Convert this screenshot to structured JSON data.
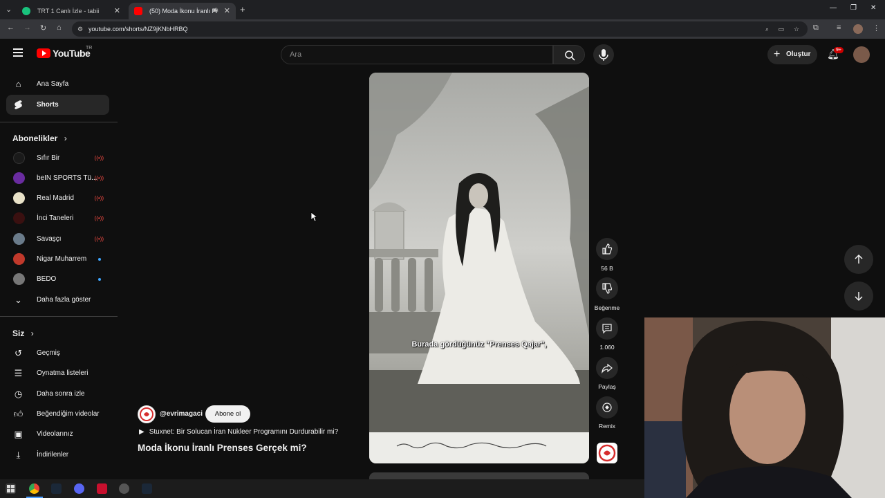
{
  "browser": {
    "tabs": [
      {
        "title": "TRT 1 Canlı İzle - tabii",
        "active": false
      },
      {
        "title": "(50) Moda İkonu İranlı Pren...",
        "active": true
      }
    ],
    "url": "youtube.com/shorts/NZ9jKNbHRBQ"
  },
  "header": {
    "logo_text": "YouTube",
    "region": "TR",
    "search_placeholder": "Ara",
    "create_label": "Oluştur",
    "notifications_badge": "9+"
  },
  "sidebar": {
    "main": [
      {
        "label": "Ana Sayfa",
        "icon": "home-icon"
      },
      {
        "label": "Shorts",
        "icon": "shorts-icon",
        "active": true
      }
    ],
    "subscriptions_title": "Abonelikler",
    "subscriptions": [
      {
        "name": "Sıfır Bir",
        "status": "live",
        "color": "#1a1a1a"
      },
      {
        "name": "beIN SPORTS Tü...",
        "status": "live",
        "color": "#6a2ca0"
      },
      {
        "name": "Real Madrid",
        "status": "live",
        "color": "#e9e2c8"
      },
      {
        "name": "İnci Taneleri",
        "status": "live",
        "color": "#3a1010"
      },
      {
        "name": "Savaşçı",
        "status": "live",
        "color": "#6a7b8a"
      },
      {
        "name": "Nigar Muharrem",
        "status": "new",
        "color": "#c0392b"
      },
      {
        "name": "BEDO",
        "status": "new",
        "color": "#777777"
      }
    ],
    "show_more_label": "Daha fazla göster",
    "you_title": "Siz",
    "you_items": [
      {
        "label": "Geçmiş",
        "icon": "history-icon"
      },
      {
        "label": "Oynatma listeleri",
        "icon": "playlist-icon"
      },
      {
        "label": "Daha sonra izle",
        "icon": "clock-icon"
      },
      {
        "label": "Beğendiğim videolar",
        "icon": "thumb-up-icon"
      },
      {
        "label": "Videolarınız",
        "icon": "video-icon"
      },
      {
        "label": "İndirilenler",
        "icon": "download-icon"
      }
    ]
  },
  "short": {
    "caption": "Burada gördüğünüz \"Prenses Qajar\",",
    "channel": "@evrimagaci",
    "subscribe_label": "Abone ol",
    "linked_video": "Stuxnet: Bir Solucan İran Nükleer Programını Durdurabilir mi?",
    "title": "Moda İkonu İranlı Prenses Gerçek mi?",
    "actions": {
      "likes": "56 B",
      "dislike_label": "Beğenme",
      "comments": "1.060",
      "share_label": "Paylaş",
      "remix_label": "Remix"
    }
  }
}
